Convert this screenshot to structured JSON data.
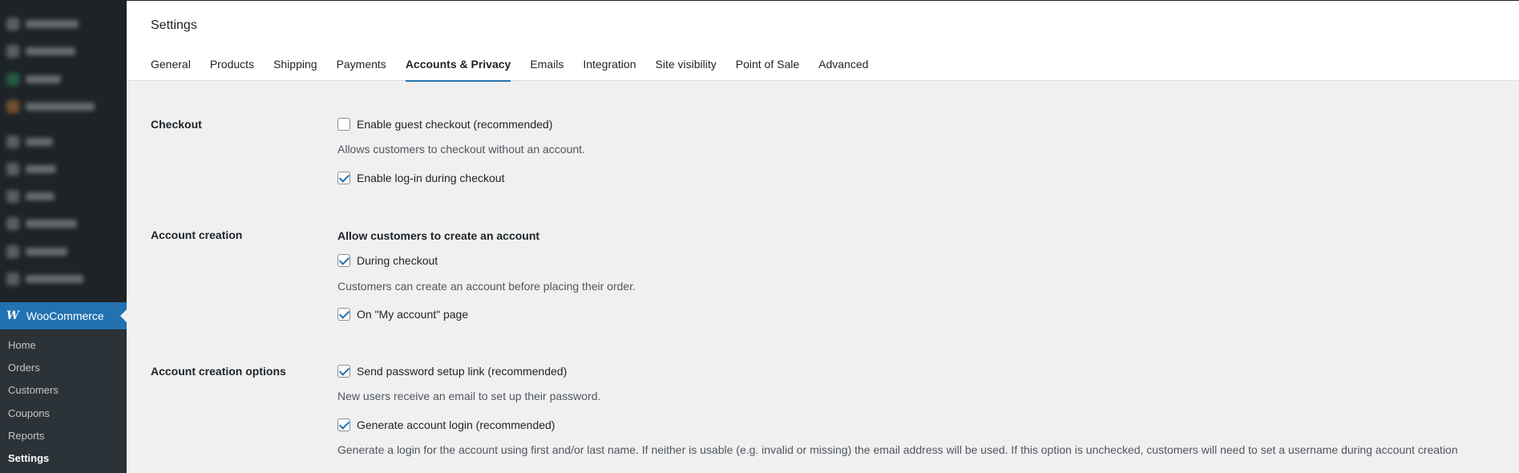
{
  "sidebar": {
    "woocommerce_label": "WooCommerce",
    "submenu": [
      "Home",
      "Orders",
      "Customers",
      "Coupons",
      "Reports",
      "Settings"
    ]
  },
  "header": {
    "title": "Settings",
    "tabs": [
      "General",
      "Products",
      "Shipping",
      "Payments",
      "Accounts & Privacy",
      "Emails",
      "Integration",
      "Site visibility",
      "Point of Sale",
      "Advanced"
    ],
    "active_tab": "Accounts & Privacy"
  },
  "checkout": {
    "label": "Checkout",
    "guest_checkout": {
      "label": "Enable guest checkout (recommended)",
      "checked": false
    },
    "guest_desc": "Allows customers to checkout without an account.",
    "login_checkout": {
      "label": "Enable log-in during checkout",
      "checked": true
    }
  },
  "account_creation": {
    "label": "Account creation",
    "heading": "Allow customers to create an account",
    "during_checkout": {
      "label": "During checkout",
      "checked": true
    },
    "during_desc": "Customers can create an account before placing their order.",
    "my_account": {
      "label": "On \"My account\" page",
      "checked": true
    }
  },
  "account_options": {
    "label": "Account creation options",
    "password_link": {
      "label": "Send password setup link (recommended)",
      "checked": true
    },
    "password_desc": "New users receive an email to set up their password.",
    "generate_login": {
      "label": "Generate account login (recommended)",
      "checked": true
    },
    "generate_desc": "Generate a login for the account using first and/or last name. If neither is usable (e.g. invalid or missing) the email address will be used. If this option is unchecked, customers will need to set a username during account creation"
  },
  "colors": {
    "accent": "#2271b1",
    "sidebar": "#1d2327"
  }
}
